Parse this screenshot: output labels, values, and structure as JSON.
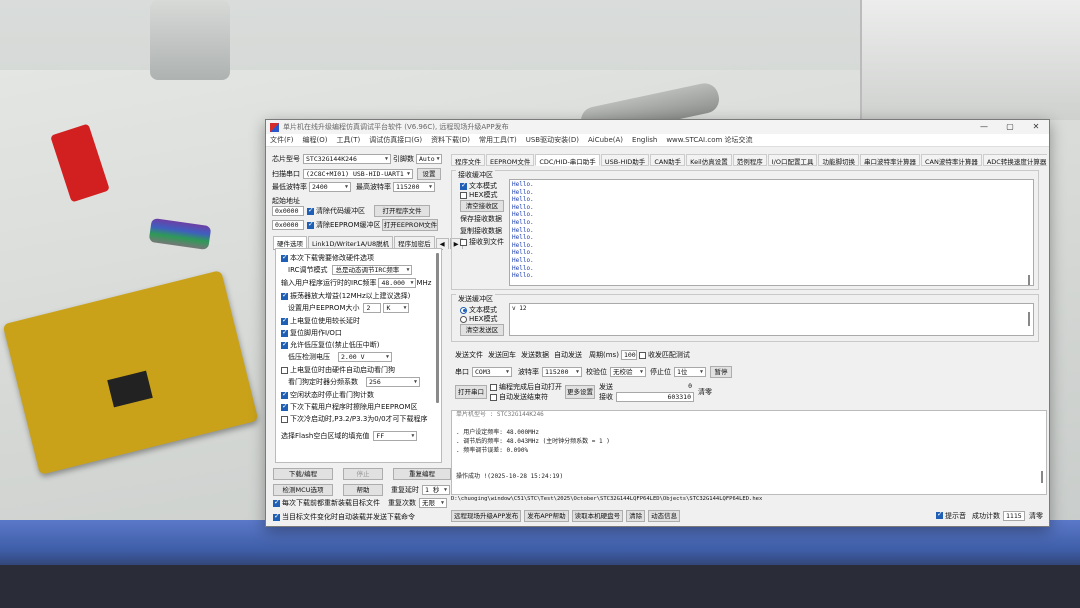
{
  "window": {
    "title": "单片机在线升级编程仿真调试平台软件 (V6.96C), 远程现场升级APP发布",
    "controls": [
      "—",
      "▢",
      "✕"
    ]
  },
  "menu": [
    "文件(F)",
    "编程(O)",
    "工具(T)",
    "调试仿真接口(G)",
    "资料下载(D)",
    "常用工具(T)",
    "USB驱动安装(D)",
    "AiCube(A)",
    "English",
    "www.STCAI.com 论坛交流"
  ],
  "left": {
    "chip_label": "芯片型号",
    "chip_value": "STC32G144K246",
    "pins_label": "引脚数",
    "pins_value": "Auto",
    "port_label": "扫描串口",
    "port_value": "(2C8C+MI01) USB-HID-UART1",
    "settings_btn": "设置",
    "min_baud_label": "最低波特率",
    "min_baud_value": "2400",
    "max_baud_label": "最高波特率",
    "max_baud_value": "115200",
    "start_addr_label": "起始地址",
    "addr1": "0x0000",
    "addr2": "0x0000",
    "clear_code_label": "清除代码缓冲区",
    "clear_eeprom_label": "清除EEPROM缓冲区",
    "open_prog_btn": "打开程序文件",
    "open_eeprom_btn": "打开EEPROM文件",
    "tabs": [
      "硬件选项",
      "Link1D/Writer1A/U8脱机",
      "程序加密后"
    ],
    "hw": {
      "apply_next": "本次下载需要修改硬件选项",
      "irc_label": "IRC调节模式",
      "irc_value": "总是动态调节IRC频率",
      "freq_label": "输入用户程序运行时的IRC频率",
      "freq_value": "48.000",
      "freq_unit": "MHz",
      "amp_label": "振荡器放大增益(12MHz以上建议选择)",
      "eeprom_size_label": "设置用户EEPROM大小",
      "eeprom_size_value": "2",
      "eeprom_size_unit": "K",
      "por_delay": "上电复位使用较长延时",
      "reset_io": "复位脚用作I/O口",
      "lvd_reset": "允许低压复位(禁止低压中断)",
      "lvd_label": "低压检测电压",
      "lvd_value": "2.00 V",
      "wdt_start": "上电复位时由硬件自动启动看门狗",
      "wdt_prescale_label": "看门狗定时器分频系数",
      "wdt_prescale_value": "256",
      "idle_wdt": "空闲状态时停止看门狗计数",
      "eeprom_erase": "下次下载用户程序时擦除用户EEPROM区",
      "p32p33": "下次冷启动时,P3.2/P3.3为0/0才可下载程序",
      "fill_label": "选择Flash空白区域的填充值",
      "fill_value": "FF"
    },
    "download_btn": "下载/编程",
    "stop_btn": "停止",
    "reprog_btn": "重复编程",
    "check_btn": "检测MCU选项",
    "help_btn": "帮助",
    "repeat_delay_label": "重复延时",
    "repeat_delay_value": "1 秒",
    "repeat_count_label": "重复次数",
    "repeat_count_value": "无限",
    "reload_each": "每次下载前都重新装载目标文件",
    "auto_download": "当目标文件变化时自动装载并发送下载命令"
  },
  "right": {
    "tabs": [
      "程序文件",
      "EEPROM文件",
      "CDC/HID-串口助手",
      "USB-HID助手",
      "CAN助手",
      "Keil仿真设置",
      "范例程序",
      "I/O口配置工具",
      "功能脚切换",
      "串口波特率计算器",
      "CAN波特率计算器",
      "ADC转换速度计算器",
      "定时"
    ],
    "recv": {
      "title": "接收缓冲区",
      "text_mode": "文本模式",
      "hex_mode": "HEX模式",
      "clear_btn": "清空接收区",
      "save_btn": "保存接收数据",
      "copy_btn": "复制接收数据",
      "recv_file": "接收到文件",
      "lines": [
        "Hello.",
        "Hello.",
        "Hello.",
        "Hello.",
        "Hello.",
        "Hello.",
        "Hello.",
        "Hello.",
        "Hello.",
        "Hello.",
        "Hello.",
        "Hello.",
        "Hello."
      ]
    },
    "send": {
      "title": "发送缓冲区",
      "text_mode": "文本模式",
      "hex_mode": "HEX模式",
      "clear_btn": "清空发送区",
      "content": "v 12"
    },
    "send_bar": {
      "send_file": "发送文件",
      "send_enter": "发送回车",
      "send_data": "发送数据",
      "auto_send": "自动发送",
      "period_label": "周期(ms)",
      "period_value": "100",
      "recv_match": "收发匹配测试"
    },
    "port_bar": {
      "port_label": "串口",
      "port_value": "COM3",
      "baud_label": "波特率",
      "baud_value": "115200",
      "parity_label": "校验位",
      "parity_value": "无校验",
      "stop_label": "停止位",
      "stop_value": "1位",
      "pause_btn": "暂停"
    },
    "open_bar": {
      "open_btn": "打开串口",
      "auto_open": "编程完成后自动打开",
      "auto_close": "自动发送结束符",
      "more_btn": "更多设置",
      "sent_label": "发送",
      "sent_value": "0",
      "recv_label": "接收",
      "recv_value": "603310",
      "clear_btn": "清零"
    },
    "log": {
      "line0": "单片机型号 : STC32G144K246",
      "line1": ". 用户设定频率: 48.000MHz",
      "line2": ". 调节后的频率: 48.043MHz (主时钟分频系数 = 1 )",
      "line3": ". 频率调节误差: 0.090%",
      "line4": "操作成功 !(2025-10-28 15:24:19)",
      "path": "D:\\chuoging\\window\\C51\\STC\\Test\\2025\\October\\STC32G144LQFP64LED\\Objects\\STC32G144LQFP64LED.hex"
    },
    "status": {
      "remote_btn": "远程现场升级APP发布",
      "help_btn": "发布APP帮助",
      "disk_btn": "读取本机硬盘号",
      "clear_btn": "清除",
      "anim_btn": "动态信息",
      "tip_label": "提示音",
      "count_label": "成功计数",
      "count_value": "1115",
      "zero_btn": "清零"
    }
  }
}
